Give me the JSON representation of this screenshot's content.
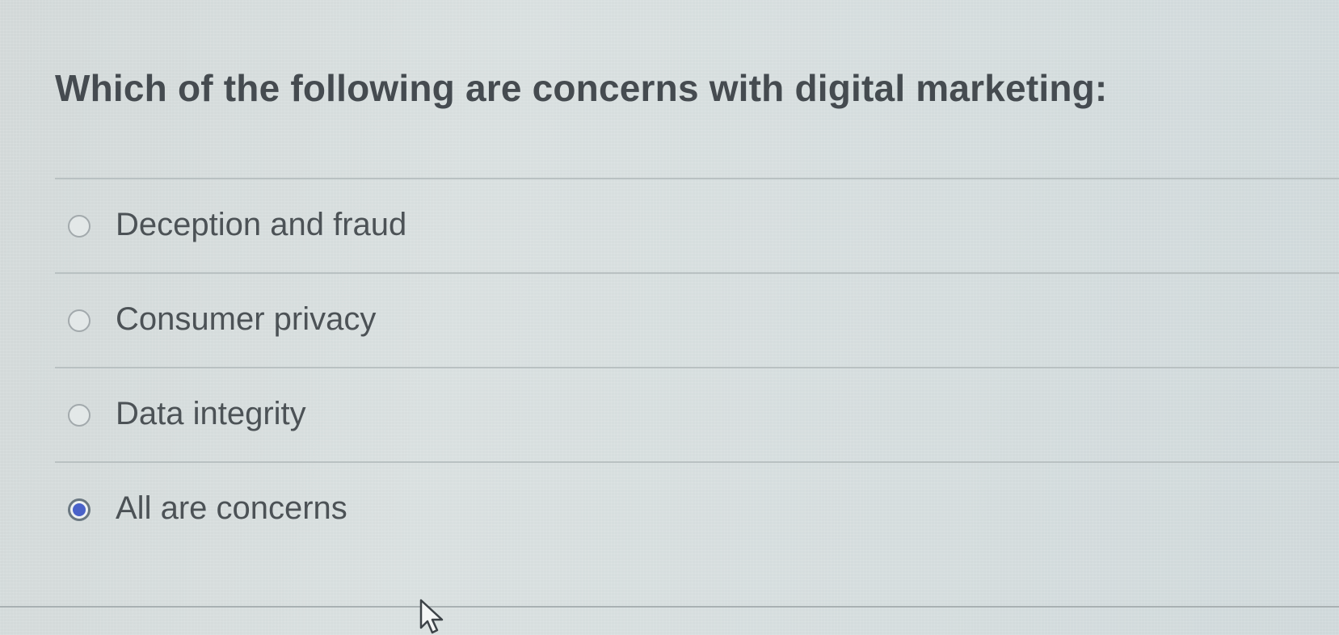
{
  "question": {
    "text": "Which of the following are concerns with digital marketing:"
  },
  "options": [
    {
      "label": "Deception and fraud",
      "selected": false
    },
    {
      "label": "Consumer privacy",
      "selected": false
    },
    {
      "label": "Data integrity",
      "selected": false
    },
    {
      "label": "All are concerns",
      "selected": true
    }
  ],
  "colors": {
    "question_text": "#454b50",
    "option_text": "#4c5256",
    "selected_radio": "#4a62c9"
  },
  "icons": {
    "cursor": "mouse-pointer-icon"
  }
}
